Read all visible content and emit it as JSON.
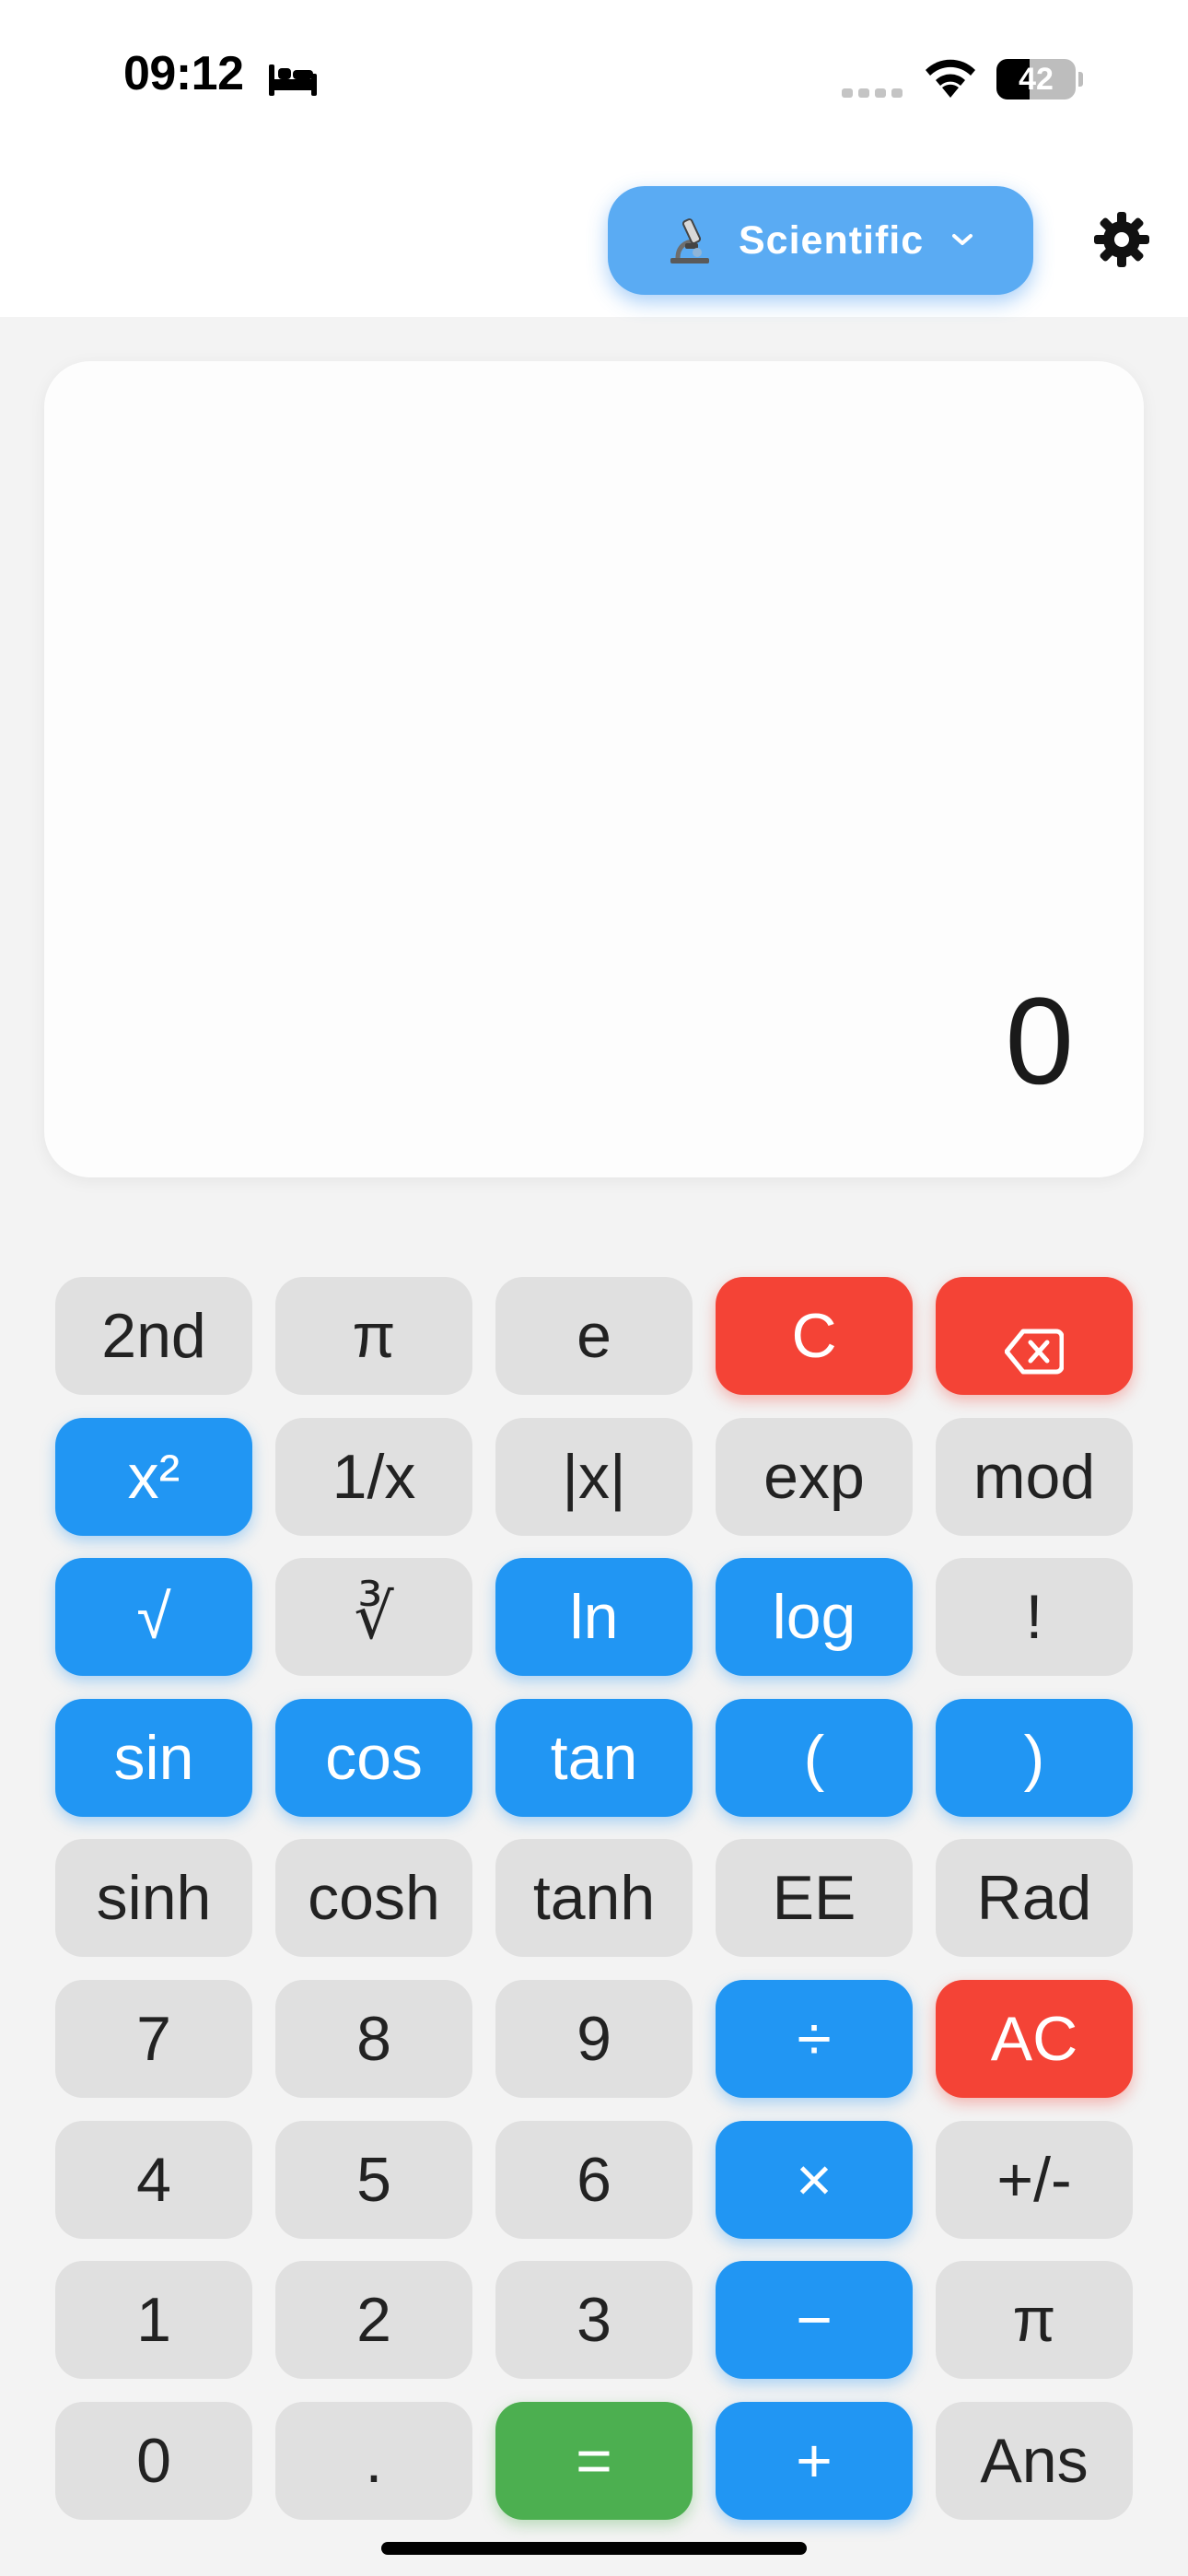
{
  "status_bar": {
    "time": "09:12",
    "battery_level": "42",
    "battery_fraction": 0.42,
    "icons": [
      "bed-icon",
      "signal-icon",
      "wifi-icon",
      "battery-icon"
    ]
  },
  "header": {
    "mode_label": "Scientific",
    "mode_icon": "microscope-icon",
    "chevron_icon": "chevron-down-icon",
    "settings_icon": "gear-icon"
  },
  "display": {
    "value": "0"
  },
  "colors": {
    "accent_blue": "#2196f3",
    "mode_button": "#5aabf3",
    "danger_red": "#f44336",
    "equals_green": "#4caf50",
    "key_gray": "#e0e0e0"
  },
  "keys": [
    [
      {
        "label": "2nd",
        "color": "gray",
        "name": "key-2nd"
      },
      {
        "label": "π",
        "color": "gray",
        "name": "key-pi"
      },
      {
        "label": "e",
        "color": "gray",
        "name": "key-e"
      },
      {
        "label": "C",
        "color": "red",
        "name": "key-clear"
      },
      {
        "label": "",
        "color": "red",
        "name": "key-backspace",
        "icon": "backspace-icon"
      }
    ],
    [
      {
        "label": "x²",
        "color": "blue",
        "name": "key-square"
      },
      {
        "label": "1/x",
        "color": "gray",
        "name": "key-reciprocal"
      },
      {
        "label": "|x|",
        "color": "gray",
        "name": "key-abs"
      },
      {
        "label": "exp",
        "color": "gray",
        "name": "key-exp"
      },
      {
        "label": "mod",
        "color": "gray",
        "name": "key-mod"
      }
    ],
    [
      {
        "label": "√",
        "color": "blue",
        "name": "key-sqrt"
      },
      {
        "label": "∛",
        "color": "gray",
        "name": "key-cbrt"
      },
      {
        "label": "ln",
        "color": "blue",
        "name": "key-ln"
      },
      {
        "label": "log",
        "color": "blue",
        "name": "key-log"
      },
      {
        "label": "!",
        "color": "gray",
        "name": "key-factorial"
      }
    ],
    [
      {
        "label": "sin",
        "color": "blue",
        "name": "key-sin"
      },
      {
        "label": "cos",
        "color": "blue",
        "name": "key-cos"
      },
      {
        "label": "tan",
        "color": "blue",
        "name": "key-tan"
      },
      {
        "label": "(",
        "color": "blue",
        "name": "key-open-paren"
      },
      {
        "label": ")",
        "color": "blue",
        "name": "key-close-paren"
      }
    ],
    [
      {
        "label": "sinh",
        "color": "gray",
        "name": "key-sinh"
      },
      {
        "label": "cosh",
        "color": "gray",
        "name": "key-cosh"
      },
      {
        "label": "tanh",
        "color": "gray",
        "name": "key-tanh"
      },
      {
        "label": "EE",
        "color": "gray",
        "name": "key-ee"
      },
      {
        "label": "Rad",
        "color": "gray",
        "name": "key-rad"
      }
    ],
    [
      {
        "label": "7",
        "color": "gray",
        "name": "key-7"
      },
      {
        "label": "8",
        "color": "gray",
        "name": "key-8"
      },
      {
        "label": "9",
        "color": "gray",
        "name": "key-9"
      },
      {
        "label": "÷",
        "color": "blue",
        "name": "key-divide"
      },
      {
        "label": "AC",
        "color": "red",
        "name": "key-all-clear"
      }
    ],
    [
      {
        "label": "4",
        "color": "gray",
        "name": "key-4"
      },
      {
        "label": "5",
        "color": "gray",
        "name": "key-5"
      },
      {
        "label": "6",
        "color": "gray",
        "name": "key-6"
      },
      {
        "label": "×",
        "color": "blue",
        "name": "key-multiply"
      },
      {
        "label": "+/-",
        "color": "gray",
        "name": "key-negate"
      }
    ],
    [
      {
        "label": "1",
        "color": "gray",
        "name": "key-1"
      },
      {
        "label": "2",
        "color": "gray",
        "name": "key-2"
      },
      {
        "label": "3",
        "color": "gray",
        "name": "key-3"
      },
      {
        "label": "−",
        "color": "blue",
        "name": "key-subtract"
      },
      {
        "label": "π",
        "color": "gray",
        "name": "key-pi-2"
      }
    ],
    [
      {
        "label": "0",
        "color": "gray",
        "name": "key-0"
      },
      {
        "label": ".",
        "color": "gray",
        "name": "key-decimal"
      },
      {
        "label": "=",
        "color": "green",
        "name": "key-equals"
      },
      {
        "label": "+",
        "color": "blue",
        "name": "key-add"
      },
      {
        "label": "Ans",
        "color": "gray",
        "name": "key-ans"
      }
    ]
  ]
}
